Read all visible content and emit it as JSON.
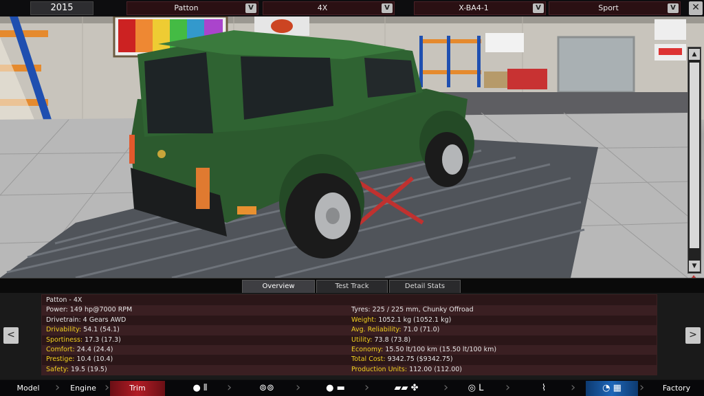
{
  "topbar": {
    "year": "2015",
    "model": "Patton",
    "trim": "4X",
    "engine": "X-BA4-1",
    "family": "Sport",
    "dropdown_glyph": "V",
    "close_glyph": "✕"
  },
  "scene": {
    "scroll_up": "▲",
    "scroll_down": "▼",
    "rotate_icon": "✥"
  },
  "tabs": [
    {
      "label": "Overview",
      "active": true
    },
    {
      "label": "Test Track",
      "active": false
    },
    {
      "label": "Detail Stats",
      "active": false
    }
  ],
  "stats": {
    "rows": [
      {
        "left": {
          "key": "Patton - 4X",
          "value": "",
          "yellow": false
        },
        "right": {
          "key": "",
          "value": "",
          "yellow": false
        }
      },
      {
        "left": {
          "key": "Power:",
          "value": "149 hp@7000 RPM",
          "yellow": false
        },
        "right": {
          "key": "Tyres:",
          "value": "225 / 225 mm, Chunky Offroad",
          "yellow": false
        }
      },
      {
        "left": {
          "key": "Drivetrain:",
          "value": "4 Gears AWD",
          "yellow": false
        },
        "right": {
          "key": "Weight:",
          "value": "1052.1 kg (1052.1 kg)",
          "yellow": true
        }
      },
      {
        "left": {
          "key": "Drivability:",
          "value": "54.1 (54.1)",
          "yellow": true
        },
        "right": {
          "key": "Avg. Reliability:",
          "value": "71.0 (71.0)",
          "yellow": true
        }
      },
      {
        "left": {
          "key": "Sportiness:",
          "value": "17.3 (17.3)",
          "yellow": true
        },
        "right": {
          "key": "Utility:",
          "value": "73.8 (73.8)",
          "yellow": true
        }
      },
      {
        "left": {
          "key": "Comfort:",
          "value": "24.4 (24.4)",
          "yellow": true
        },
        "right": {
          "key": "Economy:",
          "value": "15.50 lt/100 km (15.50 lt/100 km)",
          "yellow": true
        }
      },
      {
        "left": {
          "key": "Prestige:",
          "value": "10.4 (10.4)",
          "yellow": true
        },
        "right": {
          "key": "Total Cost:",
          "value": "9342.75 ($9342.75)",
          "yellow": true
        }
      },
      {
        "left": {
          "key": "Safety:",
          "value": "19.5 (19.5)",
          "yellow": true
        },
        "right": {
          "key": "Production Units:",
          "value": "112.00 (112.00)",
          "yellow": true
        }
      }
    ],
    "prev": "<",
    "next": ">"
  },
  "nav": {
    "model": "Model",
    "engine": "Engine",
    "trim": "Trim",
    "factory": "Factory",
    "icons": [
      "gearbox-icon",
      "wheels-icon",
      "chassis-icon",
      "body-icon",
      "interior-icon",
      "suspension-icon",
      "testing-icon"
    ]
  },
  "colors": {
    "accent_red": "#b21c25",
    "accent_blue": "#1e66b8",
    "stat_highlight": "#f2d020",
    "car_body": "#2c5a2e"
  }
}
